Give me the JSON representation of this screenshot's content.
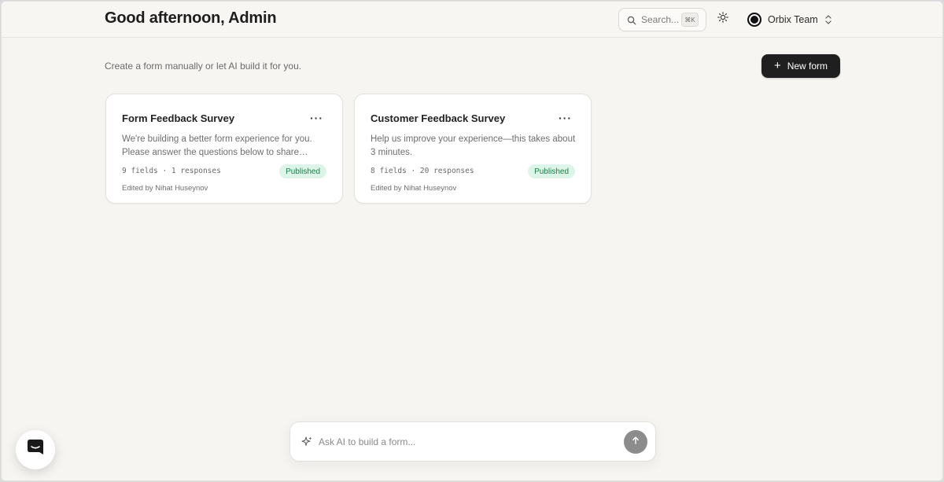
{
  "header": {
    "greeting": "Good afternoon, Admin",
    "search": {
      "placeholder": "Search...",
      "shortcut": "⌘K",
      "icon": "search-icon"
    },
    "theme_toggle_icon": "sun-icon",
    "team": {
      "name": "Orbix Team",
      "icon": "team-logo"
    }
  },
  "subheader": {
    "subtitle": "Create a form manually or let AI build it for you.",
    "new_form_label": "New form"
  },
  "forms": [
    {
      "title": "Form Feedback Survey",
      "description": "We're building a better form experience for you. Please answer the questions below to share…",
      "meta": "9 fields · 1 responses",
      "status": "Published",
      "edited_by": "Edited by Nihat Huseynov"
    },
    {
      "title": "Customer Feedback Survey",
      "description": "Help us improve your experience—this takes about 3 minutes.",
      "meta": "8 fields · 20 responses",
      "status": "Published",
      "edited_by": "Edited by Nihat Huseynov"
    }
  ],
  "ai_prompt": {
    "placeholder": "Ask AI to build a form...",
    "icon": "sparkle-icon",
    "send_icon": "arrow-up-icon"
  },
  "colors": {
    "background": "#f7f5f2",
    "primary_button": "#1f1f1f",
    "published_badge_bg": "#ddf5e8",
    "published_badge_text": "#1f7a4a"
  }
}
